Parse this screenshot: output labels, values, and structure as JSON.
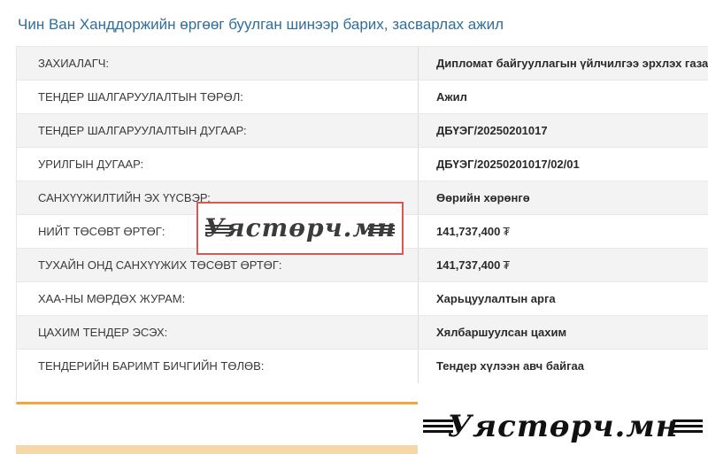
{
  "page": {
    "title": "Чин Ван Ханддоржийн өргөөг буулган шинээр барих, засварлах ажил"
  },
  "details": {
    "rows": [
      {
        "label": "ЗАХИАЛАГЧ:",
        "value": "Дипломат байгууллагын үйлчилгээ эрхлэх газар"
      },
      {
        "label": "ТЕНДЕР ШАЛГАРУУЛАЛТЫН ТӨРӨЛ:",
        "value": "Ажил"
      },
      {
        "label": "ТЕНДЕР ШАЛГАРУУЛАЛТЫН ДУГААР:",
        "value": "ДБҮЭГ/20250201017"
      },
      {
        "label": "УРИЛГЫН ДУГААР:",
        "value": "ДБҮЭГ/20250201017/02/01"
      },
      {
        "label": "САНХҮҮЖИЛТИЙН ЭХ ҮҮСВЭР:",
        "value": "Өөрийн хөрөнгө"
      },
      {
        "label": "НИЙТ ТӨСӨВТ ӨРТӨГ:",
        "value": "141,737,400",
        "currency": "₮"
      },
      {
        "label": "ТУХАЙН ОНД САНХҮҮЖИХ ТӨСӨВТ ӨРТӨГ:",
        "value": "141,737,400",
        "currency": "₮"
      },
      {
        "label": "ХАА-НЫ МӨРДӨХ ЖУРАМ:",
        "value": "Харьцуулалтын арга"
      },
      {
        "label": "ЦАХИМ ТЕНДЕР ЭСЭХ:",
        "value": "Хялбаршуулсан цахим"
      },
      {
        "label": "ТЕНДЕРИЙН БАРИМТ БИЧГИЙН ТӨЛӨВ:",
        "value": "Тендер хүлээн авч байгаа"
      }
    ]
  },
  "watermarks": {
    "center": "Уястөрч.мн",
    "corner": "Уястөрч.мн"
  },
  "colors": {
    "title": "#2f6f9a",
    "accent_border": "#f0a73a",
    "row_alt": "#f3f3f3",
    "watermark_frame": "#d45a5a"
  }
}
